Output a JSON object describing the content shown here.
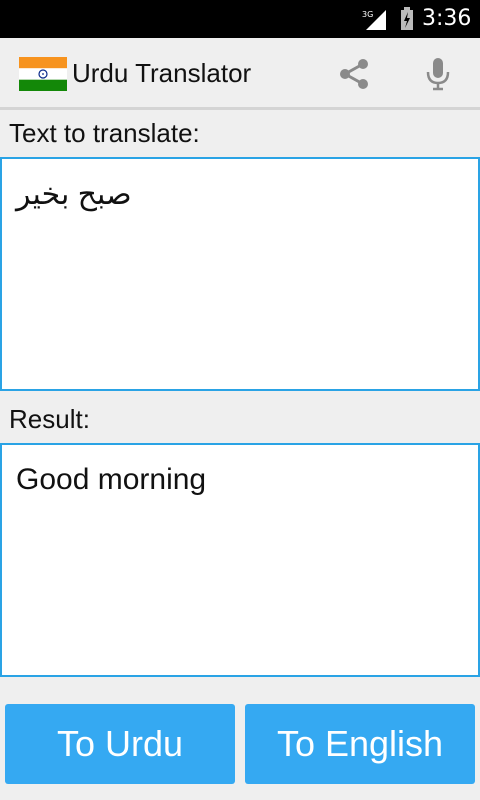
{
  "status": {
    "network": "3G",
    "time": "3:36"
  },
  "app": {
    "title": "Urdu Translator"
  },
  "actions": {
    "share_icon": "share-icon",
    "mic_icon": "mic-icon"
  },
  "source": {
    "label": "Text to translate:",
    "value": "صبح بخیر"
  },
  "result": {
    "label": "Result:",
    "value": "Good morning"
  },
  "buttons": {
    "to_urdu": "To Urdu",
    "to_english": "To English"
  },
  "colors": {
    "accent": "#35a9f2",
    "border": "#2aa3e5"
  }
}
